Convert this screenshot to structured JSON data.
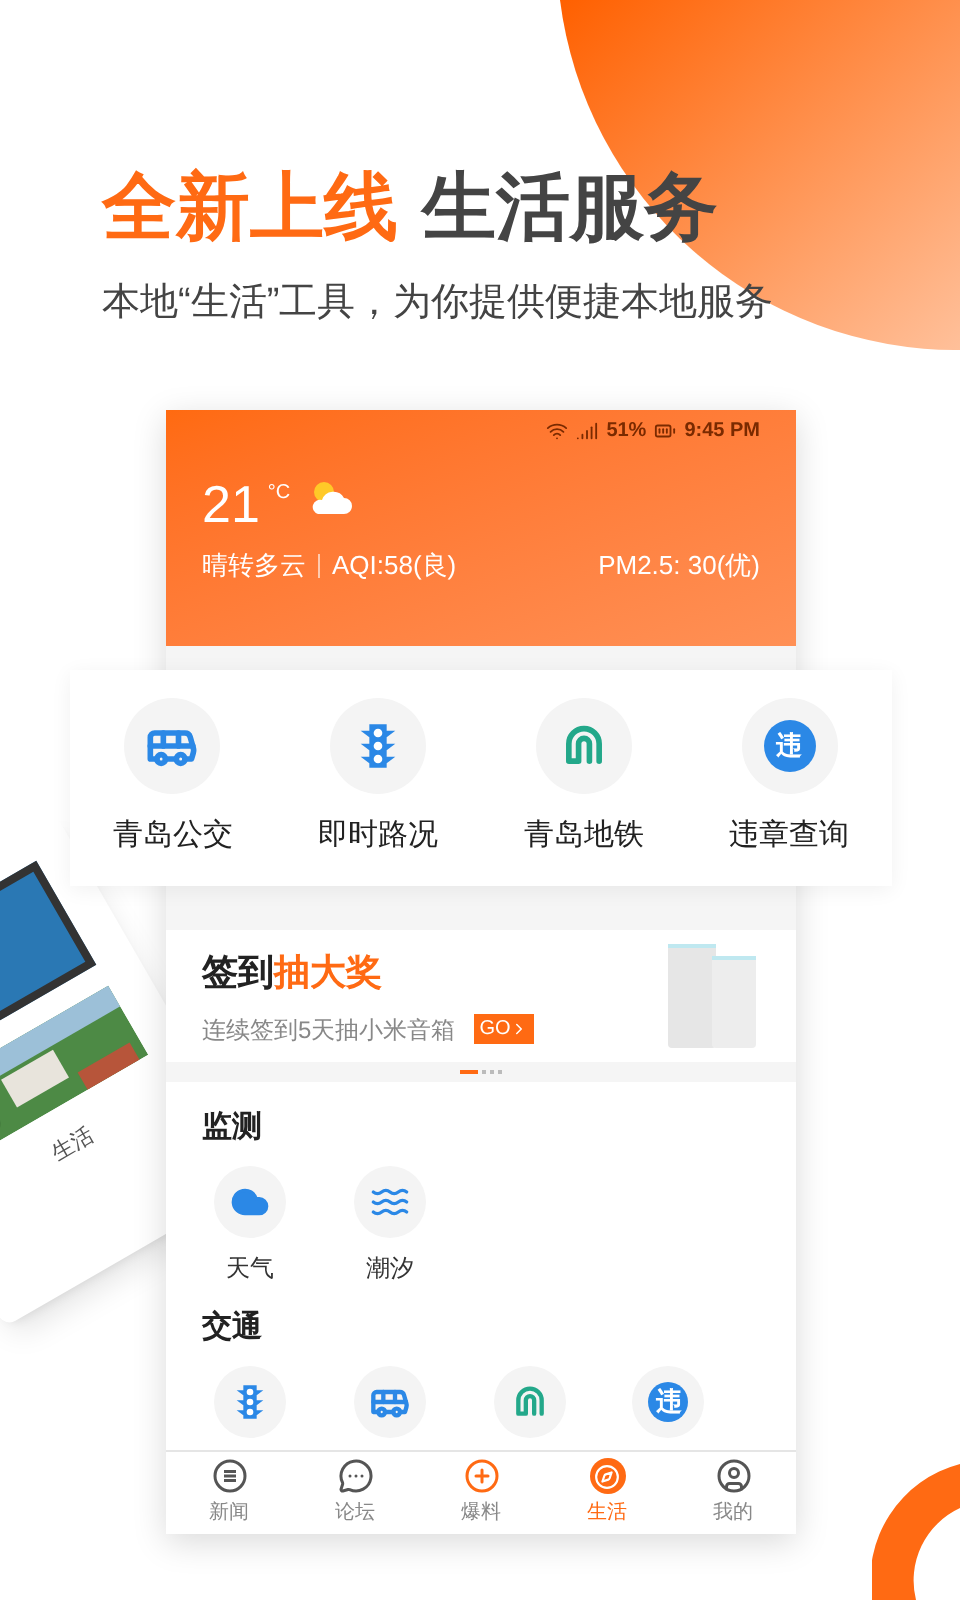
{
  "headline": {
    "highlight": "全新上线",
    "rest": "生活服务"
  },
  "subtitle": "本地“生活”工具，为你提供便捷本地服务",
  "background_phone": {
    "label": "生活"
  },
  "phone": {
    "status_bar": {
      "battery": "51%",
      "time": "9:45 PM"
    },
    "weather": {
      "temperature": "21",
      "unit": "°C",
      "condition": "晴转多云",
      "aqi": "AQI:58(良)",
      "pm25": "PM2.5: 30(优)"
    },
    "shortcuts": [
      {
        "kind": "bus",
        "label": "青岛公交"
      },
      {
        "kind": "traffic",
        "label": "即时路况"
      },
      {
        "kind": "metro",
        "label": "青岛地铁"
      },
      {
        "kind": "violation",
        "badge": "违",
        "label": "违章查询"
      }
    ],
    "banner": {
      "title": "签到",
      "highlight": "抽大奖",
      "subtitle": "连续签到5天抽小米音箱",
      "button": "GO"
    },
    "carousel": [
      {
        "selected": true
      },
      {
        "selected": false
      },
      {
        "selected": false
      },
      {
        "selected": false
      }
    ],
    "sections": [
      {
        "title": "监测",
        "items": [
          {
            "kind": "weather",
            "label": "天气"
          },
          {
            "kind": "tide",
            "label": "潮汐"
          }
        ]
      },
      {
        "title": "交通",
        "items": [
          {
            "kind": "traffic"
          },
          {
            "kind": "bus"
          },
          {
            "kind": "metro"
          },
          {
            "kind": "violation",
            "badge": "违"
          }
        ]
      }
    ],
    "tabs": [
      {
        "kind": "news",
        "label": "新闻",
        "selected": false
      },
      {
        "kind": "forum",
        "label": "论坛",
        "selected": false
      },
      {
        "kind": "report",
        "label": "爆料",
        "selected": false
      },
      {
        "kind": "life",
        "label": "生活",
        "selected": true
      },
      {
        "kind": "mine",
        "label": "我的",
        "selected": false
      }
    ]
  }
}
